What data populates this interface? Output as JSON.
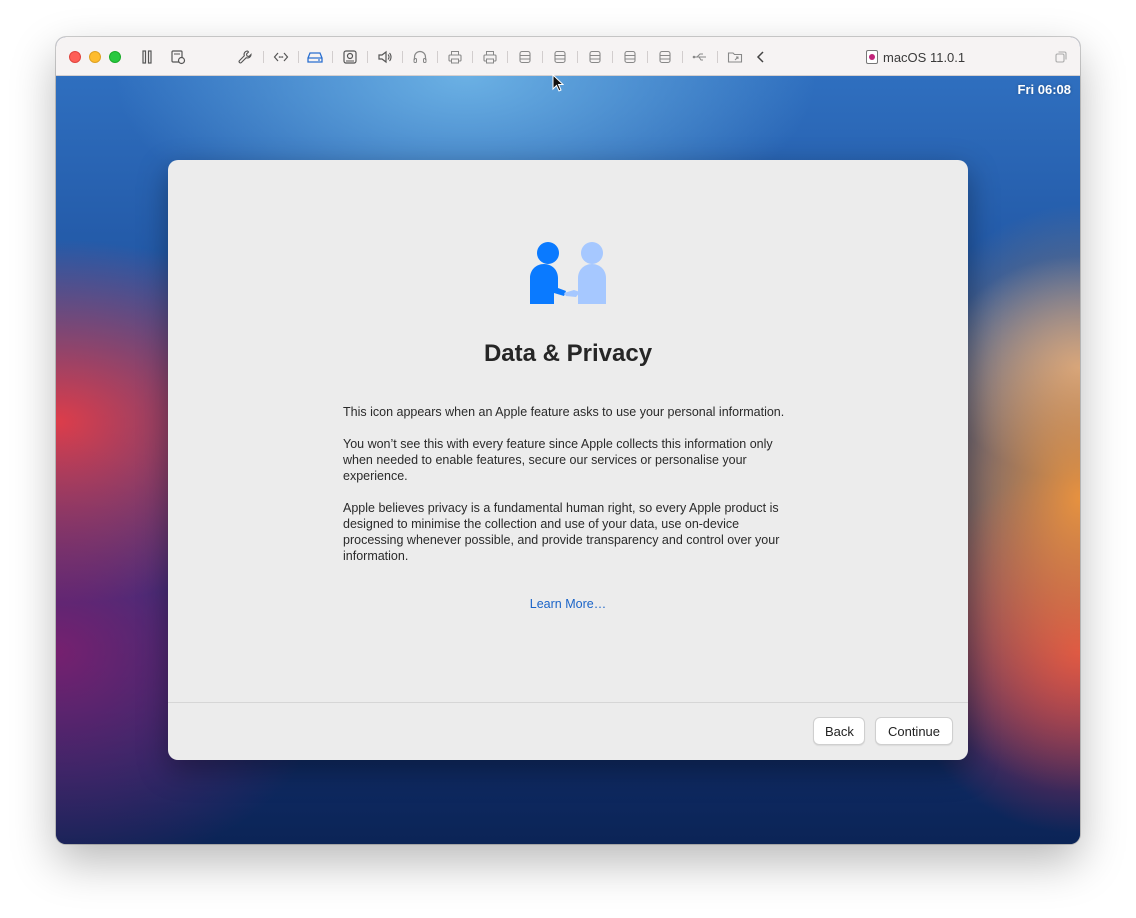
{
  "window": {
    "vm_title": "macOS 11.0.1"
  },
  "toolbar": {
    "icons": [
      "pause-icon",
      "snapshot-icon",
      "wrench-icon",
      "code-icon",
      "drive-icon",
      "webcam-icon",
      "speaker-icon",
      "headphones-icon",
      "printer-icon",
      "printer-icon",
      "disk-icon",
      "disk-icon",
      "disk-icon",
      "disk-icon",
      "disk-icon",
      "usb-icon",
      "folder-share-icon",
      "chevron-left-icon",
      "window-icon"
    ],
    "accent_color": "#1a64c8"
  },
  "menubar": {
    "clock": "Fri 06:08"
  },
  "dialog": {
    "title": "Data & Privacy",
    "paragraphs": [
      "This icon appears when an Apple feature asks to use your personal information.",
      "You won’t see this with every feature since Apple collects this information only when needed to enable features, secure our services or personalise your experience.",
      "Apple believes privacy is a fundamental human right, so every Apple product is designed to minimise the collection and use of your data, use on-device processing whenever possible, and provide transparency and control over your information."
    ],
    "learn_more": "Learn More…",
    "back_label": "Back",
    "continue_label": "Continue",
    "icon": "handshake-privacy-icon",
    "icon_colors": [
      "#0a7aff",
      "#a6c8ff"
    ]
  }
}
